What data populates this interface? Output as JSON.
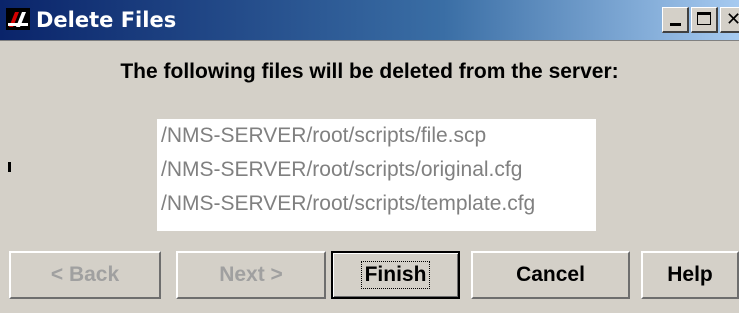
{
  "window": {
    "title": "Delete Files",
    "controls": {
      "minimize": "minimize-icon",
      "maximize": "maximize-icon",
      "close": "close-icon"
    }
  },
  "dialog": {
    "heading": "The following files will be deleted from the server:",
    "files": [
      "/NMS-SERVER/root/scripts/file.scp",
      "/NMS-SERVER/root/scripts/original.cfg",
      "/NMS-SERVER/root/scripts/template.cfg"
    ]
  },
  "buttons": {
    "back": "< Back",
    "next": "Next >",
    "finish": "Finish",
    "cancel": "Cancel",
    "help": "Help"
  },
  "colors": {
    "titlebar_start": "#0a246a",
    "titlebar_end": "#a6caf0",
    "dialog_background": "#d4d0c8",
    "file_text": "#808080",
    "disabled_text": "#a0a0a0"
  }
}
